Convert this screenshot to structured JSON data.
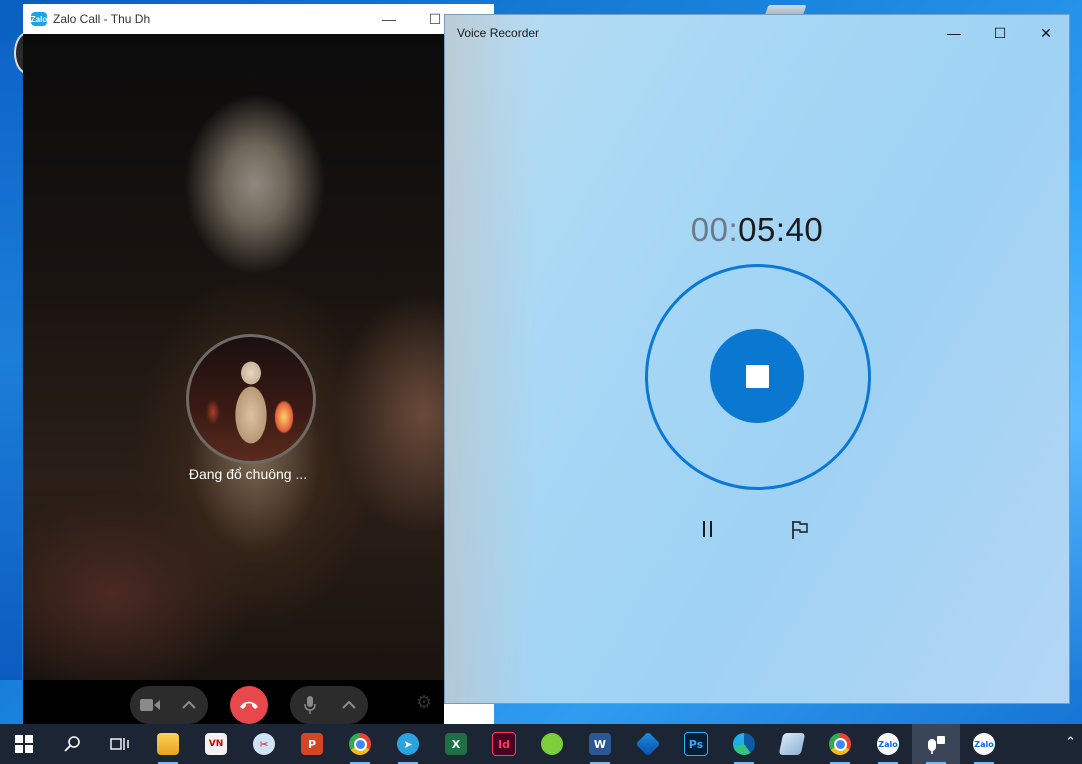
{
  "zalo": {
    "title": "Zalo Call - Thu Dh",
    "status": "Đang đổ chuông ...",
    "logo_text": "Zalo",
    "controls": [
      "video-icon",
      "chevron-up-icon",
      "hangup-icon",
      "mic-icon",
      "chevron-up-icon",
      "gear-icon"
    ]
  },
  "recorder": {
    "title": "Voice Recorder",
    "timer_hours": "00:",
    "timer_rest": "05:40",
    "accent": "#0a77d1"
  },
  "taskbar": {
    "items": [
      {
        "name": "start",
        "icon": "windows-logo-icon"
      },
      {
        "name": "search",
        "icon": "search-icon"
      },
      {
        "name": "task-view",
        "icon": "task-view-icon"
      },
      {
        "name": "file-explorer",
        "icon": "folder-icon"
      },
      {
        "name": "unikey",
        "icon": "keyboard-icon"
      },
      {
        "name": "snipping",
        "icon": "scissors-icon"
      },
      {
        "name": "powerpoint",
        "icon": "powerpoint-icon",
        "label": "P"
      },
      {
        "name": "chrome",
        "icon": "chrome-icon"
      },
      {
        "name": "telegram",
        "icon": "telegram-icon"
      },
      {
        "name": "excel",
        "icon": "excel-icon",
        "label": "X"
      },
      {
        "name": "indesign",
        "icon": "indesign-icon",
        "label": "Id"
      },
      {
        "name": "coccoc",
        "icon": "coccoc-icon"
      },
      {
        "name": "word",
        "icon": "word-icon",
        "label": "W"
      },
      {
        "name": "app-blue",
        "icon": "app-icon"
      },
      {
        "name": "photoshop",
        "icon": "photoshop-icon",
        "label": "Ps"
      },
      {
        "name": "edge",
        "icon": "edge-icon"
      },
      {
        "name": "notes",
        "icon": "notepad-icon"
      },
      {
        "name": "chrome-2",
        "icon": "chrome-icon"
      },
      {
        "name": "zalo",
        "icon": "zalo-icon",
        "label": "Zalo"
      },
      {
        "name": "voice-recorder",
        "icon": "microphone-icon"
      },
      {
        "name": "zalo-call",
        "icon": "zalo-icon",
        "label": "Zalo"
      }
    ]
  }
}
